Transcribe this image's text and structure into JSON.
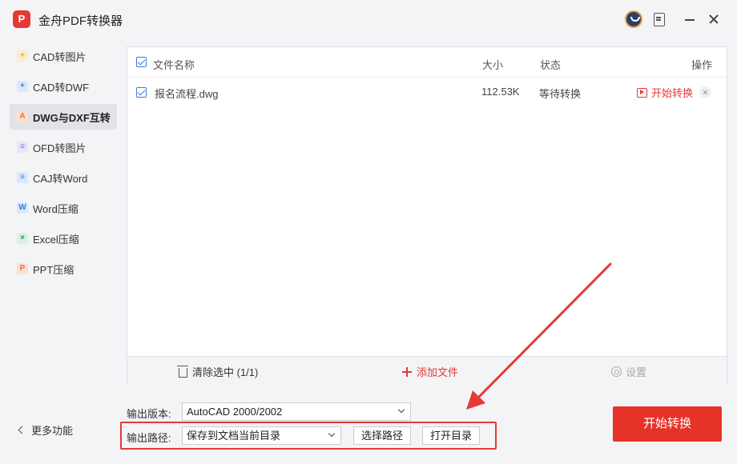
{
  "app": {
    "logo_text": "P",
    "title": "金舟PDF转换器"
  },
  "sidebar": {
    "items": [
      {
        "label": "CAD转图片",
        "icon": "cad-image-icon",
        "glyph": "+",
        "color": "#e8a33d",
        "bg": "#fdebd0",
        "active": false
      },
      {
        "label": "CAD转DWF",
        "icon": "cad-dwf-icon",
        "glyph": "+",
        "color": "#3a7be0",
        "bg": "#dbe8fb",
        "active": false
      },
      {
        "label": "DWG与DXF互转",
        "icon": "dwg-dxf-icon",
        "glyph": "A",
        "color": "#e8743d",
        "bg": "#fde0cf",
        "active": true
      },
      {
        "label": "OFD转图片",
        "icon": "ofd-image-icon",
        "glyph": "≡",
        "color": "#8e6bd8",
        "bg": "#ebe3fa",
        "active": false
      },
      {
        "label": "CAJ转Word",
        "icon": "caj-word-icon",
        "glyph": "≡",
        "color": "#3a7be0",
        "bg": "#dbe8fb",
        "active": false
      },
      {
        "label": "Word压缩",
        "icon": "word-compress-icon",
        "glyph": "W",
        "color": "#3a7be0",
        "bg": "#dbe8fb",
        "active": false
      },
      {
        "label": "Excel压缩",
        "icon": "excel-compress-icon",
        "glyph": "×",
        "color": "#2e9e5b",
        "bg": "#d8f1e2",
        "active": false
      },
      {
        "label": "PPT压缩",
        "icon": "ppt-compress-icon",
        "glyph": "P",
        "color": "#e8743d",
        "bg": "#fde0cf",
        "active": false
      }
    ],
    "more_label": "更多功能"
  },
  "table": {
    "headers": {
      "name": "文件名称",
      "size": "大小",
      "status": "状态",
      "action": "操作"
    },
    "rows": [
      {
        "name": "报名流程.dwg",
        "size": "112.53K",
        "status": "等待转换",
        "action": "开始转换",
        "checked": true
      }
    ]
  },
  "footer": {
    "clear_label": "清除选中 (1/1)",
    "add_label": "添加文件",
    "settings_label": "设置"
  },
  "output": {
    "version_label": "输出版本:",
    "version_value": "AutoCAD 2000/2002",
    "path_label": "输出路径:",
    "path_value": "保存到文档当前目录",
    "choose_path_label": "选择路径",
    "open_dir_label": "打开目录"
  },
  "actions": {
    "start_convert_label": "开始转换"
  },
  "colors": {
    "accent": "#e53935",
    "link_blue": "#3a7be0",
    "active_sidebar_bg": "#e1e3e8"
  }
}
